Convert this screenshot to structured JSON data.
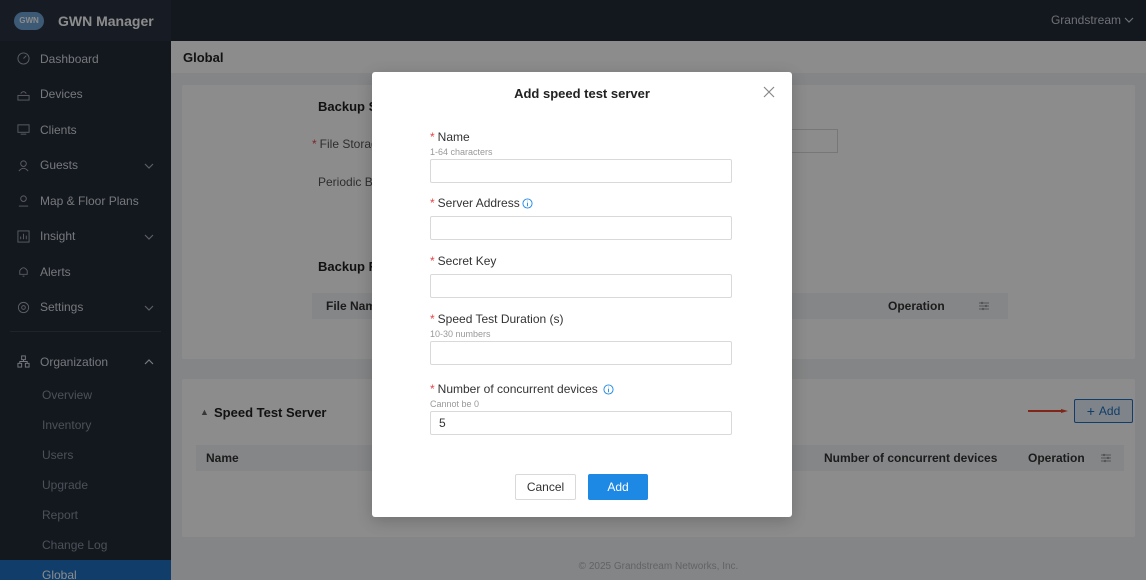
{
  "header": {
    "logo_text": "GWN",
    "app_title": "GWN Manager",
    "user_name": "Grandstream"
  },
  "sidebar": {
    "items": [
      {
        "label": "Dashboard",
        "icon": "dashboard-icon"
      },
      {
        "label": "Devices",
        "icon": "router-icon"
      },
      {
        "label": "Clients",
        "icon": "monitor-icon"
      },
      {
        "label": "Guests",
        "icon": "guest-icon"
      },
      {
        "label": "Map & Floor Plans",
        "icon": "map-pin-icon"
      },
      {
        "label": "Insight",
        "icon": "insight-icon"
      },
      {
        "label": "Alerts",
        "icon": "bell-icon"
      },
      {
        "label": "Settings",
        "icon": "gear-icon"
      }
    ],
    "organization": {
      "label": "Organization",
      "icon": "organization-icon",
      "subitems": [
        "Overview",
        "Inventory",
        "Users",
        "Upgrade",
        "Report",
        "Change Log",
        "Global"
      ],
      "active": "Global"
    }
  },
  "main": {
    "page_title": "Global",
    "backup": {
      "title_fragment": "Backup S",
      "file_storage_fragment": "File Storag",
      "periodic_fragment": "Periodic B",
      "backup_file_fragment": "Backup F",
      "file_name_fragment": "File Nam",
      "operation_header": "Operation"
    },
    "speed_test": {
      "title": "Speed Test Server",
      "add_label": "Add",
      "columns": [
        "Name",
        "Number of concurrent devices",
        "Operation"
      ]
    },
    "footer": "© 2025 Grandstream Networks, Inc."
  },
  "modal": {
    "title": "Add speed test server",
    "fields": [
      {
        "label": "Name",
        "hint": "1-64 characters",
        "value": ""
      },
      {
        "label": "Server Address",
        "hint": "",
        "value": ""
      },
      {
        "label": "Secret Key",
        "hint": "",
        "value": ""
      },
      {
        "label": "Speed Test Duration (s)",
        "hint": "10-30 numbers",
        "value": ""
      },
      {
        "label": "Number of concurrent devices",
        "hint": "Cannot be 0",
        "value": "5"
      }
    ],
    "cancel_label": "Cancel",
    "add_label": "Add"
  },
  "colors": {
    "sidebar_bg": "#232b38",
    "active_item": "#1e6fbf",
    "primary_button": "#1e88e5",
    "required_mark": "#e64545",
    "arrow": "#e8452c"
  }
}
